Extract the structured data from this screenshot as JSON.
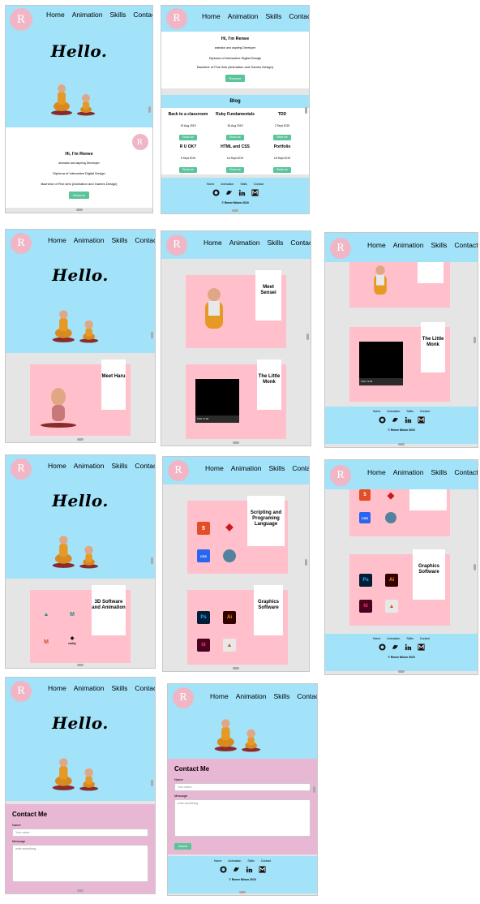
{
  "brand": {
    "logo_letter": "R"
  },
  "nav": [
    "Home",
    "Animation",
    "Skills",
    "Contact"
  ],
  "hero": {
    "greeting": "Hello."
  },
  "about": {
    "name": "Hi, I'm Renee",
    "tagline": "animator and aspiring Developer",
    "line1": "Diploma of Interactive Digital Design",
    "line2": "Bachelor of Fine Arts (Animation and Games Design)",
    "resume": "Resume"
  },
  "blog": {
    "title": "Blog",
    "posts": [
      {
        "title": "Back to a classroom",
        "date": "19 Aug 2019",
        "button": "Read me"
      },
      {
        "title": "Ruby Fundamentals",
        "date": "26 Aug 2019",
        "button": "Read me"
      },
      {
        "title": "TDD",
        "date": "2 Sept 2019",
        "button": "Read me"
      },
      {
        "title": "R U OK?",
        "date": "9 Sept 2019",
        "button": "Read me"
      },
      {
        "title": "HTML and CSS",
        "date": "16 Sept 2019",
        "button": "Read me"
      },
      {
        "title": "Portfolio",
        "date": "18 Sept 2019",
        "button": "Read me"
      }
    ]
  },
  "footer": {
    "links": [
      "Home",
      "Animation",
      "Skills",
      "Contact"
    ],
    "icons": [
      "github-icon",
      "twitter-icon",
      "linkedin-icon",
      "medium-icon"
    ],
    "copyright": "© Renee Nilsen 2019"
  },
  "animation": {
    "meet_haru": "Meet Haru",
    "meet_sensei": "Meet Sensei",
    "little_monk": "The Little Monk",
    "video_time": "0:00 / 0:20"
  },
  "skills": {
    "software_3d": "3D Software and Animation",
    "scripting": "Scripting and Programing Language",
    "graphics": "Graphics Software",
    "unity": "unity",
    "css": "CSS"
  },
  "contact": {
    "title": "Contact Me",
    "name_label": "Name",
    "name_placeholder": "Your name..",
    "message_label": "Message",
    "message_placeholder": "write something..",
    "submit": "Submit"
  },
  "colors": {
    "sky": "#a2e3fa",
    "pink": "#ffc0cb",
    "mauve": "#e8b7d4",
    "green": "#5ac49a",
    "logo": "#f0b6c6"
  }
}
